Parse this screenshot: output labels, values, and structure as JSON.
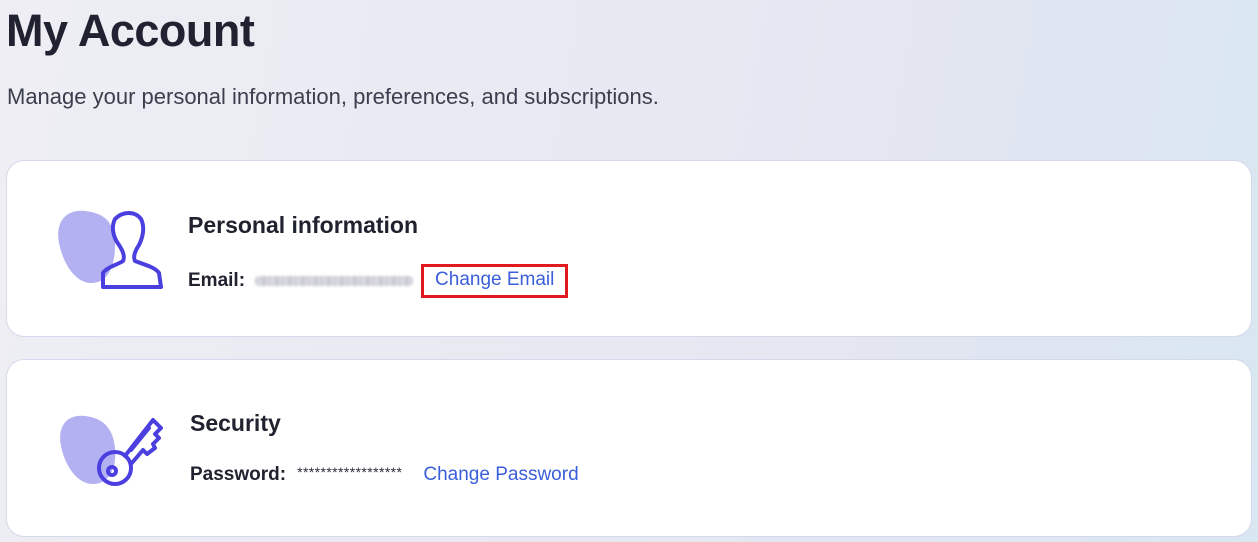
{
  "page": {
    "title": "My Account",
    "subtitle": "Manage your personal information, preferences, and subscriptions."
  },
  "personal": {
    "title": "Personal information",
    "email_label": "Email:",
    "email_value": "",
    "change_email_label": "Change Email",
    "icon": "user-icon"
  },
  "security": {
    "title": "Security",
    "password_label": "Password:",
    "password_value": "******************",
    "change_password_label": "Change Password",
    "icon": "key-icon"
  },
  "colors": {
    "accent_link": "#3a5fd9",
    "icon_stroke": "#4b3fe0",
    "icon_blob": "#b4b1f2",
    "highlight_box": "#e01a1e"
  }
}
